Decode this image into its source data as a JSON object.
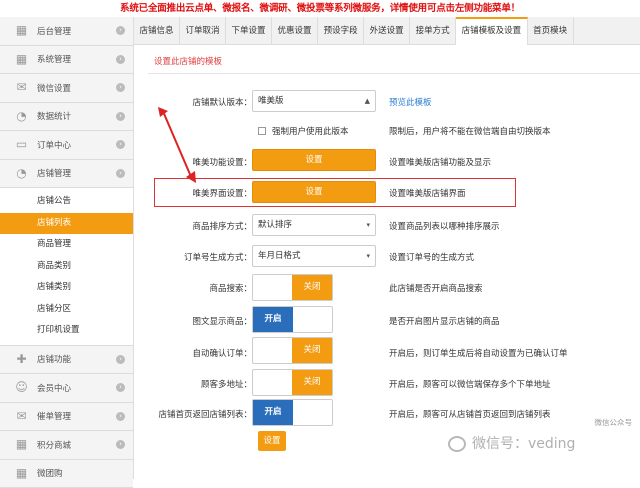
{
  "banner": "系统已全面推出云点单、微报名、微调研、微投票等系列微服务，详情使用可点击左侧功能菜单！",
  "sidebar": {
    "items_top": [
      {
        "label": "后台管理",
        "icon": "grid-icon"
      },
      {
        "label": "系统管理",
        "icon": "grid-icon"
      },
      {
        "label": "微信设置",
        "icon": "mail-icon"
      },
      {
        "label": "数据统计",
        "icon": "pie-icon"
      },
      {
        "label": "订单中心",
        "icon": "cart-icon"
      },
      {
        "label": "店铺管理",
        "icon": "pie-icon"
      }
    ],
    "sub_items": [
      "店铺公告",
      "店铺列表",
      "商品管理",
      "商品类别",
      "店铺类别",
      "店铺分区",
      "打印机设置"
    ],
    "active_sub": "店铺列表",
    "items_bottom": [
      {
        "label": "店铺功能",
        "icon": "plus-icon"
      },
      {
        "label": "会员中心",
        "icon": "user-icon"
      },
      {
        "label": "催单管理",
        "icon": "mail-icon"
      },
      {
        "label": "积分商城",
        "icon": "grid-icon"
      },
      {
        "label": "微团购",
        "icon": "grid-icon"
      }
    ]
  },
  "tabs": [
    "店铺信息",
    "订单取消",
    "下单设置",
    "优惠设置",
    "预设字段",
    "外送设置",
    "接单方式",
    "店铺模板及设置",
    "首页模块"
  ],
  "active_tab": "店铺模板及设置",
  "section_title": "设置此店铺的模板",
  "form": {
    "default_version": {
      "label": "店铺默认版本：",
      "value": "唯美版",
      "link": "预览此模板"
    },
    "force_checkbox": {
      "label": "强制用户使用此版本",
      "desc": "限制后，用户将不能在微信端自由切换版本"
    },
    "feature_settings": {
      "label": "唯美功能设置：",
      "button": "设置",
      "desc": "设置唯美版店铺功能及显示"
    },
    "ui_settings": {
      "label": "唯美界面设置：",
      "button": "设置",
      "desc": "设置唯美版店铺界面"
    },
    "sort": {
      "label": "商品排序方式：",
      "value": "默认排序",
      "desc": "设置商品列表以哪种排序展示"
    },
    "order_no": {
      "label": "订单号生成方式：",
      "value": "年月日格式",
      "desc": "设置订单号的生成方式"
    },
    "product_search": {
      "label": "商品搜索：",
      "state": "关闭",
      "desc": "此店铺是否开启商品搜索"
    },
    "image_display": {
      "label": "图文显示商品：",
      "state": "开启",
      "desc": "是否开启图片显示店铺的商品"
    },
    "auto_confirm": {
      "label": "自动确认订单：",
      "state": "关闭",
      "desc": "开启后，则订单生成后将自动设置为已确认订单"
    },
    "multi_address": {
      "label": "顾客多地址：",
      "state": "关闭",
      "desc": "开启后，顾客可以微信端保存多个下单地址"
    },
    "back_to_list": {
      "label": "店铺首页返回店铺列表：",
      "state": "开启",
      "desc": "开启后，顾客可从店铺首页返回到店铺列表"
    },
    "save_button": "设置"
  },
  "watermark": "微信号：veding",
  "corner_logo": "微信公众号"
}
